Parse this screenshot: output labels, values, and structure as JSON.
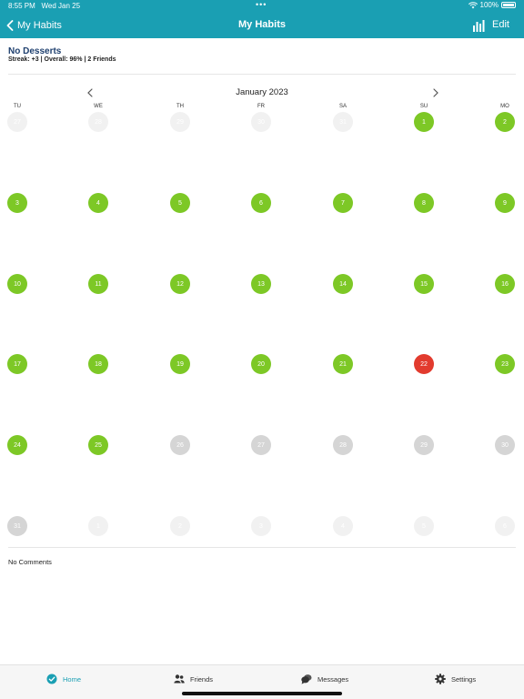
{
  "status": {
    "time": "8:55 PM",
    "date": "Wed Jan 25",
    "dots": "•••",
    "battery": "100%"
  },
  "nav": {
    "back_label": "My Habits",
    "title": "My Habits",
    "edit_label": "Edit"
  },
  "habit": {
    "title": "No Desserts",
    "stats": "Streak: +3  |  Overall: 96%  |  2 Friends"
  },
  "calendar": {
    "month_label": "January 2023",
    "weekdays": [
      "TU",
      "WE",
      "TH",
      "FR",
      "SA",
      "SU",
      "MO"
    ],
    "weeks": [
      [
        {
          "n": "27",
          "s": "faint"
        },
        {
          "n": "28",
          "s": "faint"
        },
        {
          "n": "29",
          "s": "faint"
        },
        {
          "n": "30",
          "s": "faint"
        },
        {
          "n": "31",
          "s": "faint"
        },
        {
          "n": "1",
          "s": "green"
        },
        {
          "n": "2",
          "s": "green"
        }
      ],
      [
        {
          "n": "3",
          "s": "green"
        },
        {
          "n": "4",
          "s": "green"
        },
        {
          "n": "5",
          "s": "green"
        },
        {
          "n": "6",
          "s": "green"
        },
        {
          "n": "7",
          "s": "green"
        },
        {
          "n": "8",
          "s": "green"
        },
        {
          "n": "9",
          "s": "green"
        }
      ],
      [
        {
          "n": "10",
          "s": "green"
        },
        {
          "n": "11",
          "s": "green"
        },
        {
          "n": "12",
          "s": "green"
        },
        {
          "n": "13",
          "s": "green"
        },
        {
          "n": "14",
          "s": "green"
        },
        {
          "n": "15",
          "s": "green"
        },
        {
          "n": "16",
          "s": "green"
        }
      ],
      [
        {
          "n": "17",
          "s": "green"
        },
        {
          "n": "18",
          "s": "green"
        },
        {
          "n": "19",
          "s": "green"
        },
        {
          "n": "20",
          "s": "green"
        },
        {
          "n": "21",
          "s": "green"
        },
        {
          "n": "22",
          "s": "red"
        },
        {
          "n": "23",
          "s": "green"
        }
      ],
      [
        {
          "n": "24",
          "s": "green"
        },
        {
          "n": "25",
          "s": "green"
        },
        {
          "n": "26",
          "s": "gray"
        },
        {
          "n": "27",
          "s": "gray"
        },
        {
          "n": "28",
          "s": "gray"
        },
        {
          "n": "29",
          "s": "gray"
        },
        {
          "n": "30",
          "s": "gray"
        }
      ],
      [
        {
          "n": "31",
          "s": "gray"
        },
        {
          "n": "1",
          "s": "faint"
        },
        {
          "n": "2",
          "s": "faint"
        },
        {
          "n": "3",
          "s": "faint"
        },
        {
          "n": "4",
          "s": "faint"
        },
        {
          "n": "5",
          "s": "faint"
        },
        {
          "n": "6",
          "s": "faint"
        }
      ]
    ]
  },
  "comments": {
    "label": "No Comments"
  },
  "tabs": [
    {
      "label": "Home",
      "icon": "check-circle-icon",
      "active": true
    },
    {
      "label": "Friends",
      "icon": "people-icon",
      "active": false
    },
    {
      "label": "Messages",
      "icon": "chat-bubbles-icon",
      "active": false
    },
    {
      "label": "Settings",
      "icon": "gear-icon",
      "active": false
    }
  ],
  "colors": {
    "accent": "#1a9fb3",
    "success": "#7dc826",
    "fail": "#e23b2e",
    "future": "#d5d5d5",
    "title": "#1e3f6e"
  }
}
